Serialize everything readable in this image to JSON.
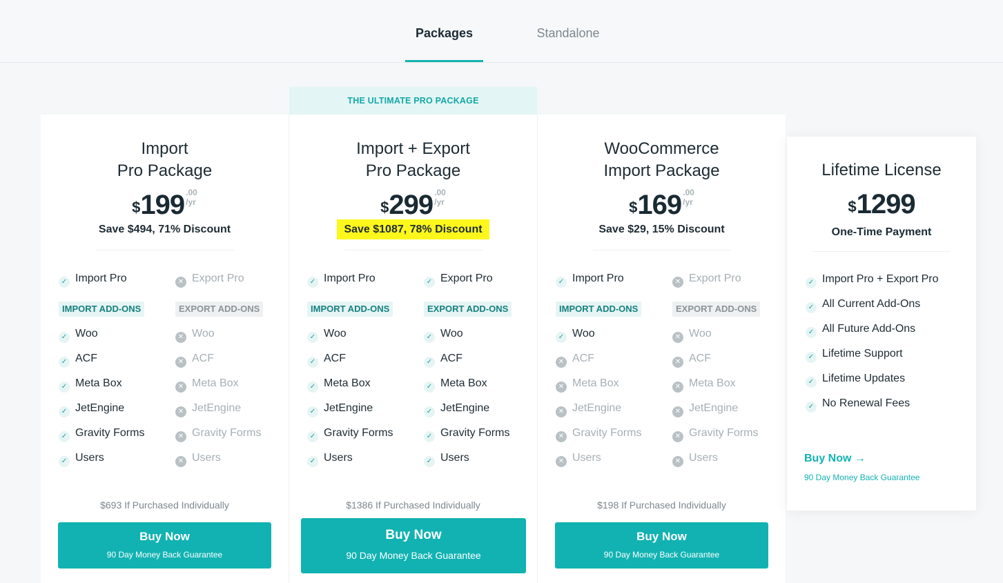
{
  "tabs": {
    "active": "Packages",
    "inactive": "Standalone"
  },
  "banner": "THE ULTIMATE PRO PACKAGE",
  "colors": {
    "accent": "#12b2b2",
    "highlight": "#fdf71c",
    "check_bg": "#e6f4f4",
    "cross": "#b9c1c5"
  },
  "cards": [
    {
      "title1": "Import",
      "title2": "Pro Package",
      "currency": "$",
      "price": "199",
      "cents": ".00",
      "period": "/yr",
      "save": "Save $494, 71% Discount",
      "features": [
        [
          "Import Pro",
          true
        ],
        [
          "Export Pro",
          false
        ]
      ],
      "addon_import": "IMPORT ADD-ONS",
      "addon_export": "EXPORT ADD-ONS",
      "addons_import": [
        [
          "Woo",
          true
        ],
        [
          "ACF",
          true
        ],
        [
          "Meta Box",
          true
        ],
        [
          "JetEngine",
          true
        ],
        [
          "Gravity Forms",
          true
        ],
        [
          "Users",
          true
        ]
      ],
      "addons_export": [
        [
          "Woo",
          false
        ],
        [
          "ACF",
          false
        ],
        [
          "Meta Box",
          false
        ],
        [
          "JetEngine",
          false
        ],
        [
          "Gravity Forms",
          false
        ],
        [
          "Users",
          false
        ]
      ],
      "individual": "$693 If Purchased Individually",
      "btn": "Buy Now",
      "btn_sub": "90 Day Money Back Guarantee"
    },
    {
      "title1": "Import + Export",
      "title2": "Pro Package",
      "currency": "$",
      "price": "299",
      "cents": ".00",
      "period": "/yr",
      "save": "Save $1087, 78% Discount",
      "features": [
        [
          "Import Pro",
          true
        ],
        [
          "Export Pro",
          true
        ]
      ],
      "addon_import": "IMPORT ADD-ONS",
      "addon_export": "EXPORT ADD-ONS",
      "addons_import": [
        [
          "Woo",
          true
        ],
        [
          "ACF",
          true
        ],
        [
          "Meta Box",
          true
        ],
        [
          "JetEngine",
          true
        ],
        [
          "Gravity Forms",
          true
        ],
        [
          "Users",
          true
        ]
      ],
      "addons_export": [
        [
          "Woo",
          true
        ],
        [
          "ACF",
          true
        ],
        [
          "Meta Box",
          true
        ],
        [
          "JetEngine",
          true
        ],
        [
          "Gravity Forms",
          true
        ],
        [
          "Users",
          true
        ]
      ],
      "individual": "$1386 If Purchased Individually",
      "btn": "Buy Now",
      "btn_sub": "90 Day Money Back Guarantee"
    },
    {
      "title1": "WooCommerce",
      "title2": "Import Package",
      "currency": "$",
      "price": "169",
      "cents": ".00",
      "period": "/yr",
      "save": "Save $29, 15% Discount",
      "features": [
        [
          "Import Pro",
          true
        ],
        [
          "Export Pro",
          false
        ]
      ],
      "addon_import": "IMPORT ADD-ONS",
      "addon_export": "EXPORT ADD-ONS",
      "addons_import": [
        [
          "Woo",
          true
        ],
        [
          "ACF",
          false
        ],
        [
          "Meta Box",
          false
        ],
        [
          "JetEngine",
          false
        ],
        [
          "Gravity Forms",
          false
        ],
        [
          "Users",
          false
        ]
      ],
      "addons_export": [
        [
          "Woo",
          false
        ],
        [
          "ACF",
          false
        ],
        [
          "Meta Box",
          false
        ],
        [
          "JetEngine",
          false
        ],
        [
          "Gravity Forms",
          false
        ],
        [
          "Users",
          false
        ]
      ],
      "individual": "$198 If Purchased Individually",
      "btn": "Buy Now",
      "btn_sub": "90 Day Money Back Guarantee"
    }
  ],
  "lifetime": {
    "title": "Lifetime License",
    "currency": "$",
    "price": "1299",
    "payment": "One-Time Payment",
    "features": [
      "Import Pro + Export Pro",
      "All Current Add-Ons",
      "All Future Add-Ons",
      "Lifetime Support",
      "Lifetime Updates",
      "No Renewal Fees"
    ],
    "buy": "Buy Now →",
    "guarantee": "90 Day Money Back Guarantee"
  }
}
